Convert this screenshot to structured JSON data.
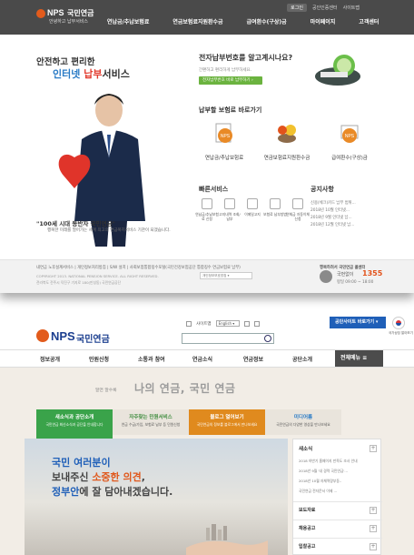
{
  "top": {
    "header": {
      "logo_en": "NPS",
      "logo_kr": "국민연금",
      "logo_slogan": "안녕하고 납부서비스",
      "util": [
        "로그인",
        "공인인증센터",
        "사이트맵"
      ],
      "gnb": [
        "연납금/추납보험료",
        "연금보험료지원환수금",
        "급여환수(구상)금",
        "마이페이지",
        "고객센터"
      ]
    },
    "hero": {
      "copy1": "안전하고 편리한",
      "copy2_a": "인터넷 ",
      "copy2_b": "납부",
      "copy2_c": "서비스",
      "caption1": "\"100세 시대 동반자 국민연금\"",
      "caption2": "행복한 미래를 열어가는 세계 최고의 연금복지서비스 기관이 되겠습니다."
    },
    "question": {
      "title": "전자납부번호를 알고계시나요?",
      "desc": "간편하고 편리하게 납부하세요.",
      "button": "전자납부번호 바로 납부하기 ›"
    },
    "services": {
      "title": "납부할 보험료 바로가기",
      "items": [
        "연납금/추납보험료",
        "연금보험료지원환수금",
        "급여환수(구상)금"
      ]
    },
    "quick": {
      "title": "빠른서비스",
      "items": [
        "연납금/추납보험료 신청",
        "고지내역 조회/납부",
        "이메일고지",
        "보험료 납부방법",
        "연체금 자동이체 신청"
      ]
    },
    "notice": {
      "title": "공지사항",
      "items": [
        "신용(체크)카드 납부 범위...",
        "2018년 10월 인터넷...",
        "2018년 9월 인터넷 납...",
        "2018년 12월 인터넷 납..."
      ]
    },
    "footer": {
      "links": "내연금 노후설계서비스  |  개인정보처리방침  |  S/W 설치  |  사회보험통합징수포털(국민건강보험공단 통합징수 연금보험료 납부)",
      "copy1": "COPYRIGHT 2013. NATIONAL PENSION SERVICE. ALL RIGHT RESERVED.",
      "copy2": "전라북도 전주시 덕진구 기지로 180(만성동) 국민연금공단",
      "select": "개인정보보호방침 ▾",
      "cc_label": "행복하려서 국민연금 콜센터",
      "cc_name": "국번없이",
      "cc_num": "1355",
      "hours": "평일 09:00 ~ 18:00"
    }
  },
  "bottom": {
    "logo_en": "NPS",
    "logo_kr": "국민연금",
    "util_sitemap": "사이트맵",
    "lang": "English ▾",
    "shortcut": "공단사이트 바로가기 ▾",
    "flag_label": "국가상징 알아보기",
    "gnb": [
      "정보공개",
      "민원신청",
      "소통과 참여",
      "연금소식",
      "연금정보",
      "공단소개"
    ],
    "allmenu": "전체메뉴 ≡",
    "slogan_small": "알면 알수록",
    "slogan": "나의 연금, 국민 연금",
    "tabs": [
      {
        "title": "새소식과 공단소개",
        "sub": "국민연금 최신소식과 공단을 안내합니다"
      },
      {
        "title": "자주찾는 민원서비스",
        "sub": "연금 수급/가입, 보험료 납부 등 민원신청"
      },
      {
        "title": "블로그 열어보기",
        "sub": "국민연금의 정보를 블로그에서 만나보세요"
      },
      {
        "title": "미디어룸",
        "sub": "국민연금의 다양한 영상을 만나보세요"
      }
    ],
    "banner": {
      "l1_hl": "국민 여러분",
      "l1": "이",
      "l2a": "보내주신 ",
      "l2_hl": "소중한 의견",
      "l2b": ",",
      "l3_hl": "정부안",
      "l3": "에 잘 담아내겠습니다."
    },
    "side": {
      "news_title": "새소식",
      "news": [
        "2018 하반기 홈페이지 만족도 조사 안내",
        "2018년 9월 '내 경력 국민연금'...",
        "2018년 10월 자체역량부동..",
        "국민연금 전자문서 이제 ..."
      ],
      "sections": [
        "보도자료",
        "채용공고",
        "입찰공고"
      ]
    }
  }
}
